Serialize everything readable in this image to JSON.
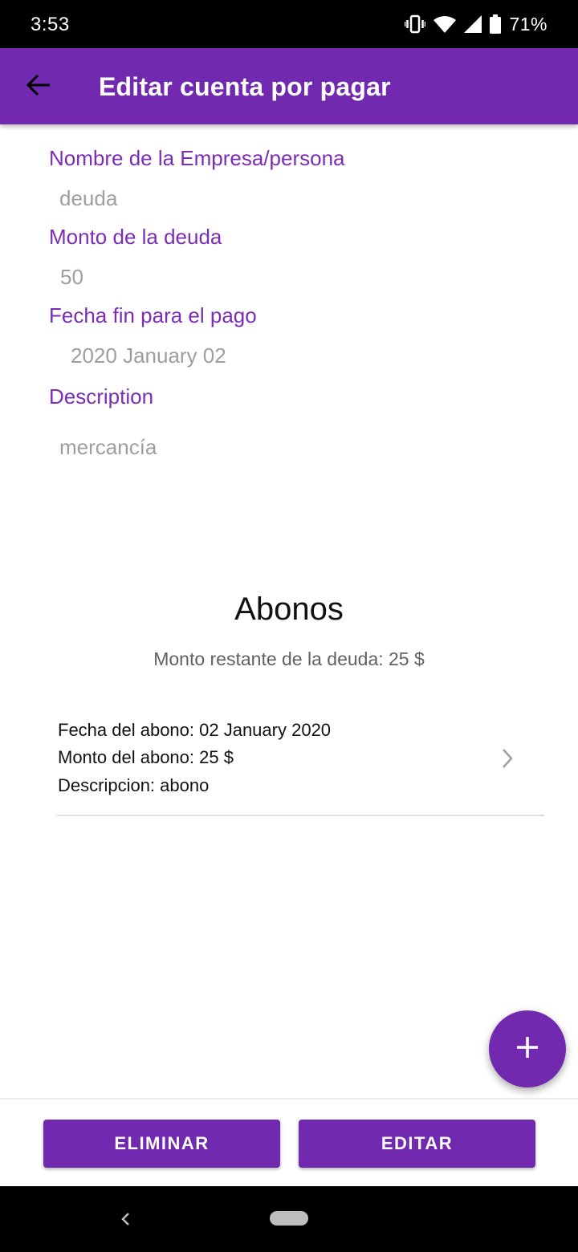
{
  "status_bar": {
    "time": "3:53",
    "battery_percent": "71%",
    "icons": [
      "vibrate-icon",
      "wifi-icon",
      "signal-icon",
      "battery-icon"
    ]
  },
  "app_bar": {
    "title": "Editar cuenta por pagar",
    "back_icon": "arrow-back-icon",
    "background_color": "#7129b0"
  },
  "form": {
    "name_label": "Nombre de la Empresa/persona",
    "name_value": "deuda",
    "amount_label": "Monto de la deuda",
    "amount_value": "50",
    "due_date_label": "Fecha fin para el pago",
    "due_date_value": "2020 January 02",
    "description_label": "Description",
    "description_value": "mercancía",
    "label_color": "#7b2db5"
  },
  "payments": {
    "title": "Abonos",
    "remaining_text": "Monto restante de la deuda: 25 $",
    "items": [
      {
        "date_line": "Fecha del abono: 02 January 2020",
        "amount_line": "Monto del abono: 25 $",
        "description_line": "Descripcion: abono"
      }
    ]
  },
  "fab": {
    "icon": "plus-icon"
  },
  "actions": {
    "delete_label": "ELIMINAR",
    "edit_label": "EDITAR"
  },
  "nav_bar": {
    "icons": [
      "nav-back-icon",
      "home-pill-icon"
    ]
  }
}
